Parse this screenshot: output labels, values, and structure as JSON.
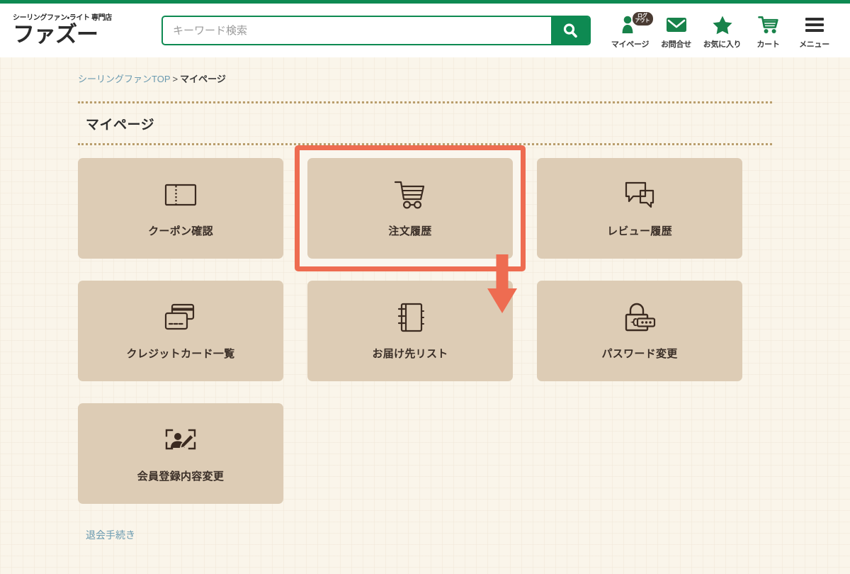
{
  "brand": {
    "tagline": "シーリングファン・ライト 専門店",
    "name": "ファズー"
  },
  "search": {
    "placeholder": "キーワード検索",
    "value": "",
    "button_icon": "search-icon"
  },
  "header_nav": [
    {
      "label": "マイページ",
      "icon": "user-icon",
      "badge_line1": "ログ",
      "badge_line2": "アウト"
    },
    {
      "label": "お問合せ",
      "icon": "envelope-icon"
    },
    {
      "label": "お気に入り",
      "icon": "star-icon"
    },
    {
      "label": "カート",
      "icon": "cart-icon"
    },
    {
      "label": "メニュー",
      "icon": "hamburger-icon"
    }
  ],
  "breadcrumb": {
    "home": "シーリングファンTOP",
    "separator": ">",
    "current": "マイページ"
  },
  "page": {
    "title": "マイページ"
  },
  "tiles": [
    {
      "label": "クーポン確認",
      "icon": "coupon-ticket-icon",
      "highlighted": false
    },
    {
      "label": "注文履歴",
      "icon": "shopping-cart-icon",
      "highlighted": true
    },
    {
      "label": "レビュー履歴",
      "icon": "chat-bubbles-icon",
      "highlighted": false
    },
    {
      "label": "クレジットカード一覧",
      "icon": "credit-cards-icon",
      "highlighted": false
    },
    {
      "label": "お届け先リスト",
      "icon": "address-book-icon",
      "highlighted": false
    },
    {
      "label": "パスワード変更",
      "icon": "padlock-password-icon",
      "highlighted": false
    },
    {
      "label": "会員登録内容変更",
      "icon": "profile-edit-icon",
      "highlighted": false
    }
  ],
  "footer": {
    "withdraw_label": "退会手続き"
  },
  "colors": {
    "brand_green": "#0e8a52",
    "accent_red": "#ee6c51",
    "tile_bg": "#ddccb5",
    "page_bg": "#faf5ea",
    "link_blue": "#6a9ab0",
    "dotted_border": "#b99e6d",
    "icon_brown": "#3b2a20"
  }
}
